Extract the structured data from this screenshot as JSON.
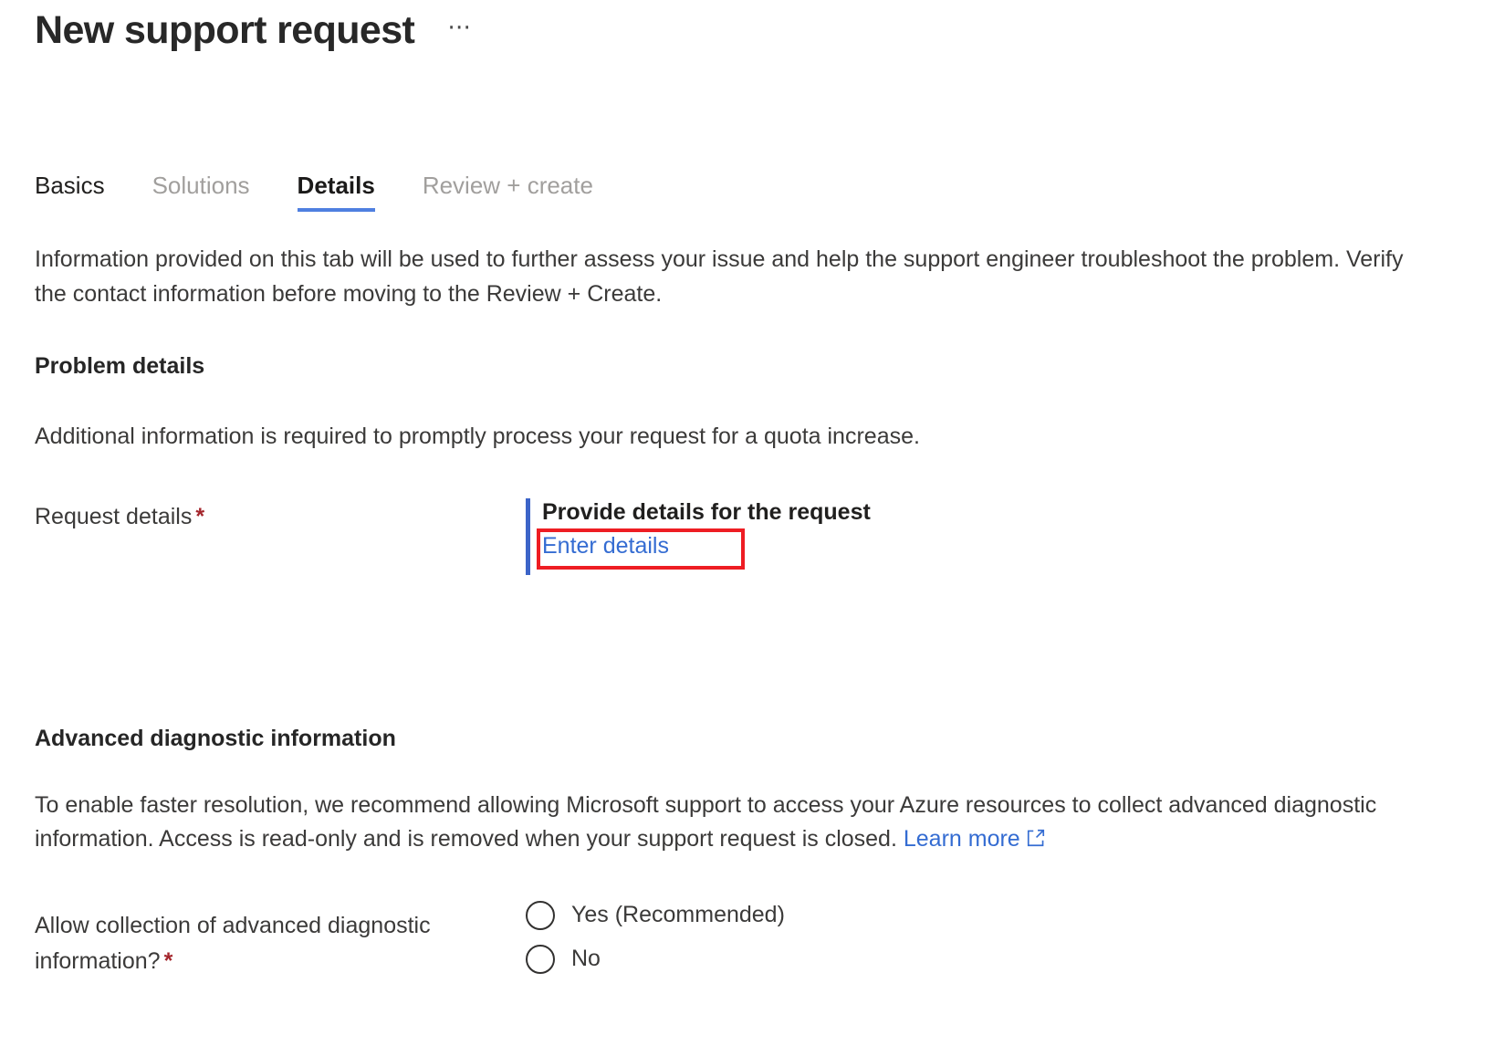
{
  "header": {
    "title": "New support request",
    "more_menu": "⋯",
    "more_menu_name": "more-options"
  },
  "tabs": [
    {
      "label": "Basics",
      "state": "visited"
    },
    {
      "label": "Solutions",
      "state": "muted"
    },
    {
      "label": "Details",
      "state": "active"
    },
    {
      "label": "Review + create",
      "state": "muted"
    }
  ],
  "intro": "Information provided on this tab will be used to further assess your issue and help the support engineer troubleshoot the problem. Verify the contact information before moving to the Review + Create.",
  "problem_details": {
    "heading": "Problem details",
    "description": "Additional information is required to promptly process your request for a quota increase.",
    "request_details": {
      "label": "Request details",
      "required_marker": "*",
      "control_heading": "Provide details for the request",
      "link_label": "Enter details"
    }
  },
  "advanced_diagnostic": {
    "heading": "Advanced diagnostic information",
    "description_before_link": "To enable faster resolution, we recommend allowing Microsoft support to access your Azure resources to collect advanced diagnostic information. Access is read-only and is removed when your support request is closed. ",
    "learn_more_label": "Learn more",
    "external_link_icon": "external-link-icon",
    "question_label": "Allow collection of advanced diagnostic information?",
    "required_marker": "*",
    "options": [
      {
        "label": "Yes (Recommended)",
        "selected": false
      },
      {
        "label": "No",
        "selected": false
      }
    ]
  },
  "colors": {
    "accent_blue": "#4f7fe0",
    "link_blue": "#346cd2",
    "bar_blue": "#3c64c8",
    "annotation_red": "#ee1d23",
    "required_red": "#a4262c",
    "text_primary": "#323130",
    "text_muted": "#a19f9d"
  }
}
